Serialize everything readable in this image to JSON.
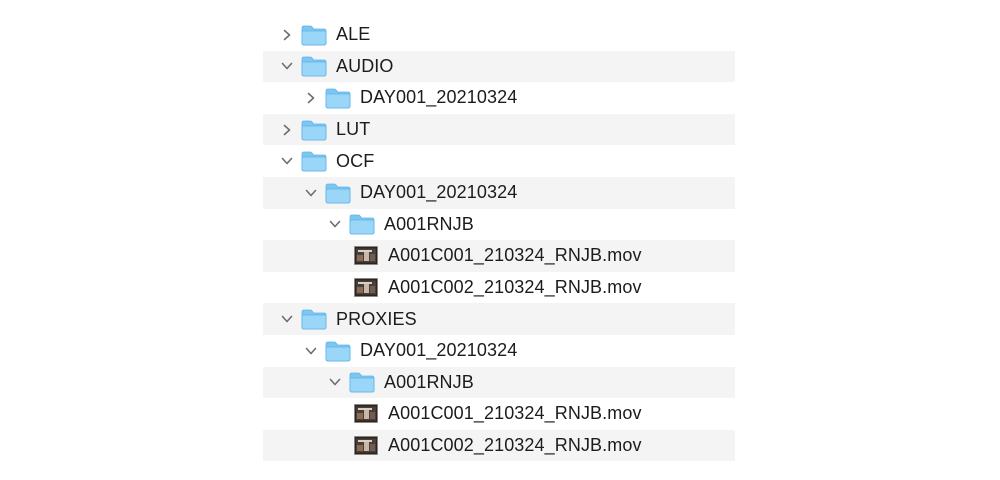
{
  "tree": {
    "rows": [
      {
        "label": "ALE",
        "depth": 0,
        "kind": "folder",
        "state": "collapsed"
      },
      {
        "label": "AUDIO",
        "depth": 0,
        "kind": "folder",
        "state": "expanded"
      },
      {
        "label": "DAY001_20210324",
        "depth": 1,
        "kind": "folder",
        "state": "collapsed"
      },
      {
        "label": "LUT",
        "depth": 0,
        "kind": "folder",
        "state": "collapsed"
      },
      {
        "label": "OCF",
        "depth": 0,
        "kind": "folder",
        "state": "expanded"
      },
      {
        "label": "DAY001_20210324",
        "depth": 1,
        "kind": "folder",
        "state": "expanded"
      },
      {
        "label": "A001RNJB",
        "depth": 2,
        "kind": "folder",
        "state": "expanded"
      },
      {
        "label": "A001C001_210324_RNJB.mov",
        "depth": 3,
        "kind": "file",
        "state": "none"
      },
      {
        "label": "A001C002_210324_RNJB.mov",
        "depth": 3,
        "kind": "file",
        "state": "none"
      },
      {
        "label": "PROXIES",
        "depth": 0,
        "kind": "folder",
        "state": "expanded"
      },
      {
        "label": "DAY001_20210324",
        "depth": 1,
        "kind": "folder",
        "state": "expanded"
      },
      {
        "label": "A001RNJB",
        "depth": 2,
        "kind": "folder",
        "state": "expanded"
      },
      {
        "label": "A001C001_210324_RNJB.mov",
        "depth": 3,
        "kind": "file",
        "state": "none"
      },
      {
        "label": "A001C002_210324_RNJB.mov",
        "depth": 3,
        "kind": "file",
        "state": "none"
      }
    ]
  },
  "colors": {
    "folder_body": "#7cc7f2",
    "folder_front": "#9ad6f7",
    "folder_edge": "#5fb2e6",
    "alt_row": "#f4f4f4",
    "chevron": "#6e6e6e",
    "text": "#1c1c1c"
  },
  "icons": {
    "folder": "folder-icon",
    "file": "video-file-icon",
    "collapsed": "chevron-right-icon",
    "expanded": "chevron-down-icon"
  }
}
